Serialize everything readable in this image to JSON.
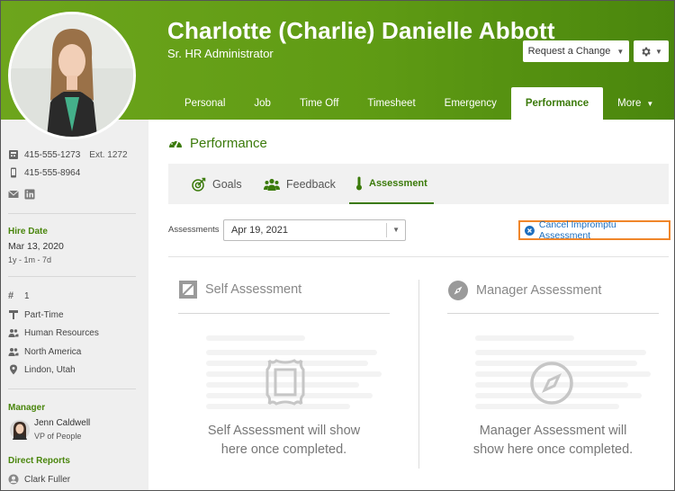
{
  "window": {
    "title": "Performance"
  },
  "employee": {
    "name": "Charlotte (Charlie) Danielle Abbott",
    "job_title": "Sr. HR Administrator"
  },
  "header": {
    "request_change_label": "Request a Change",
    "gear_icon": "gear-icon"
  },
  "tabs": [
    {
      "label": "Personal"
    },
    {
      "label": "Job"
    },
    {
      "label": "Time Off"
    },
    {
      "label": "Timesheet"
    },
    {
      "label": "Emergency"
    },
    {
      "label": "Performance",
      "active": true
    },
    {
      "label": "More"
    }
  ],
  "sidebar": {
    "work_phone": "415-555-1273",
    "ext": "Ext. 1272",
    "mobile_phone": "415-555-8964",
    "hire_date_label": "Hire Date",
    "hire_date": "Mar 13, 2020",
    "tenure": "1y - 1m - 7d",
    "employee_number": "1",
    "employment_status": "Part-Time",
    "department": "Human Resources",
    "division": "North America",
    "location": "Lindon, Utah",
    "manager_label": "Manager",
    "manager_name": "Jenn Caldwell",
    "manager_title": "VP of People",
    "direct_reports_label": "Direct Reports",
    "direct_reports": [
      "Clark Fuller"
    ]
  },
  "main": {
    "section_title": "Performance",
    "subtabs": [
      {
        "label": "Goals"
      },
      {
        "label": "Feedback"
      },
      {
        "label": "Assessment",
        "active": true
      }
    ],
    "assessments_label": "Assessments",
    "assessment_selected": "Apr 19, 2021",
    "cancel_label": "Cancel Impromptu Assessment",
    "self": {
      "title": "Self Assessment",
      "message_line1": "Self Assessment will show",
      "message_line2": "here once completed."
    },
    "manager": {
      "title": "Manager Assessment",
      "message_line1": "Manager Assessment will",
      "message_line2": "show here once completed."
    }
  },
  "colors": {
    "brand_green": "#5f9b14",
    "accent_text_green": "#3b7a0a",
    "link_blue": "#1d6fbf",
    "focus_orange": "#f0862a"
  }
}
